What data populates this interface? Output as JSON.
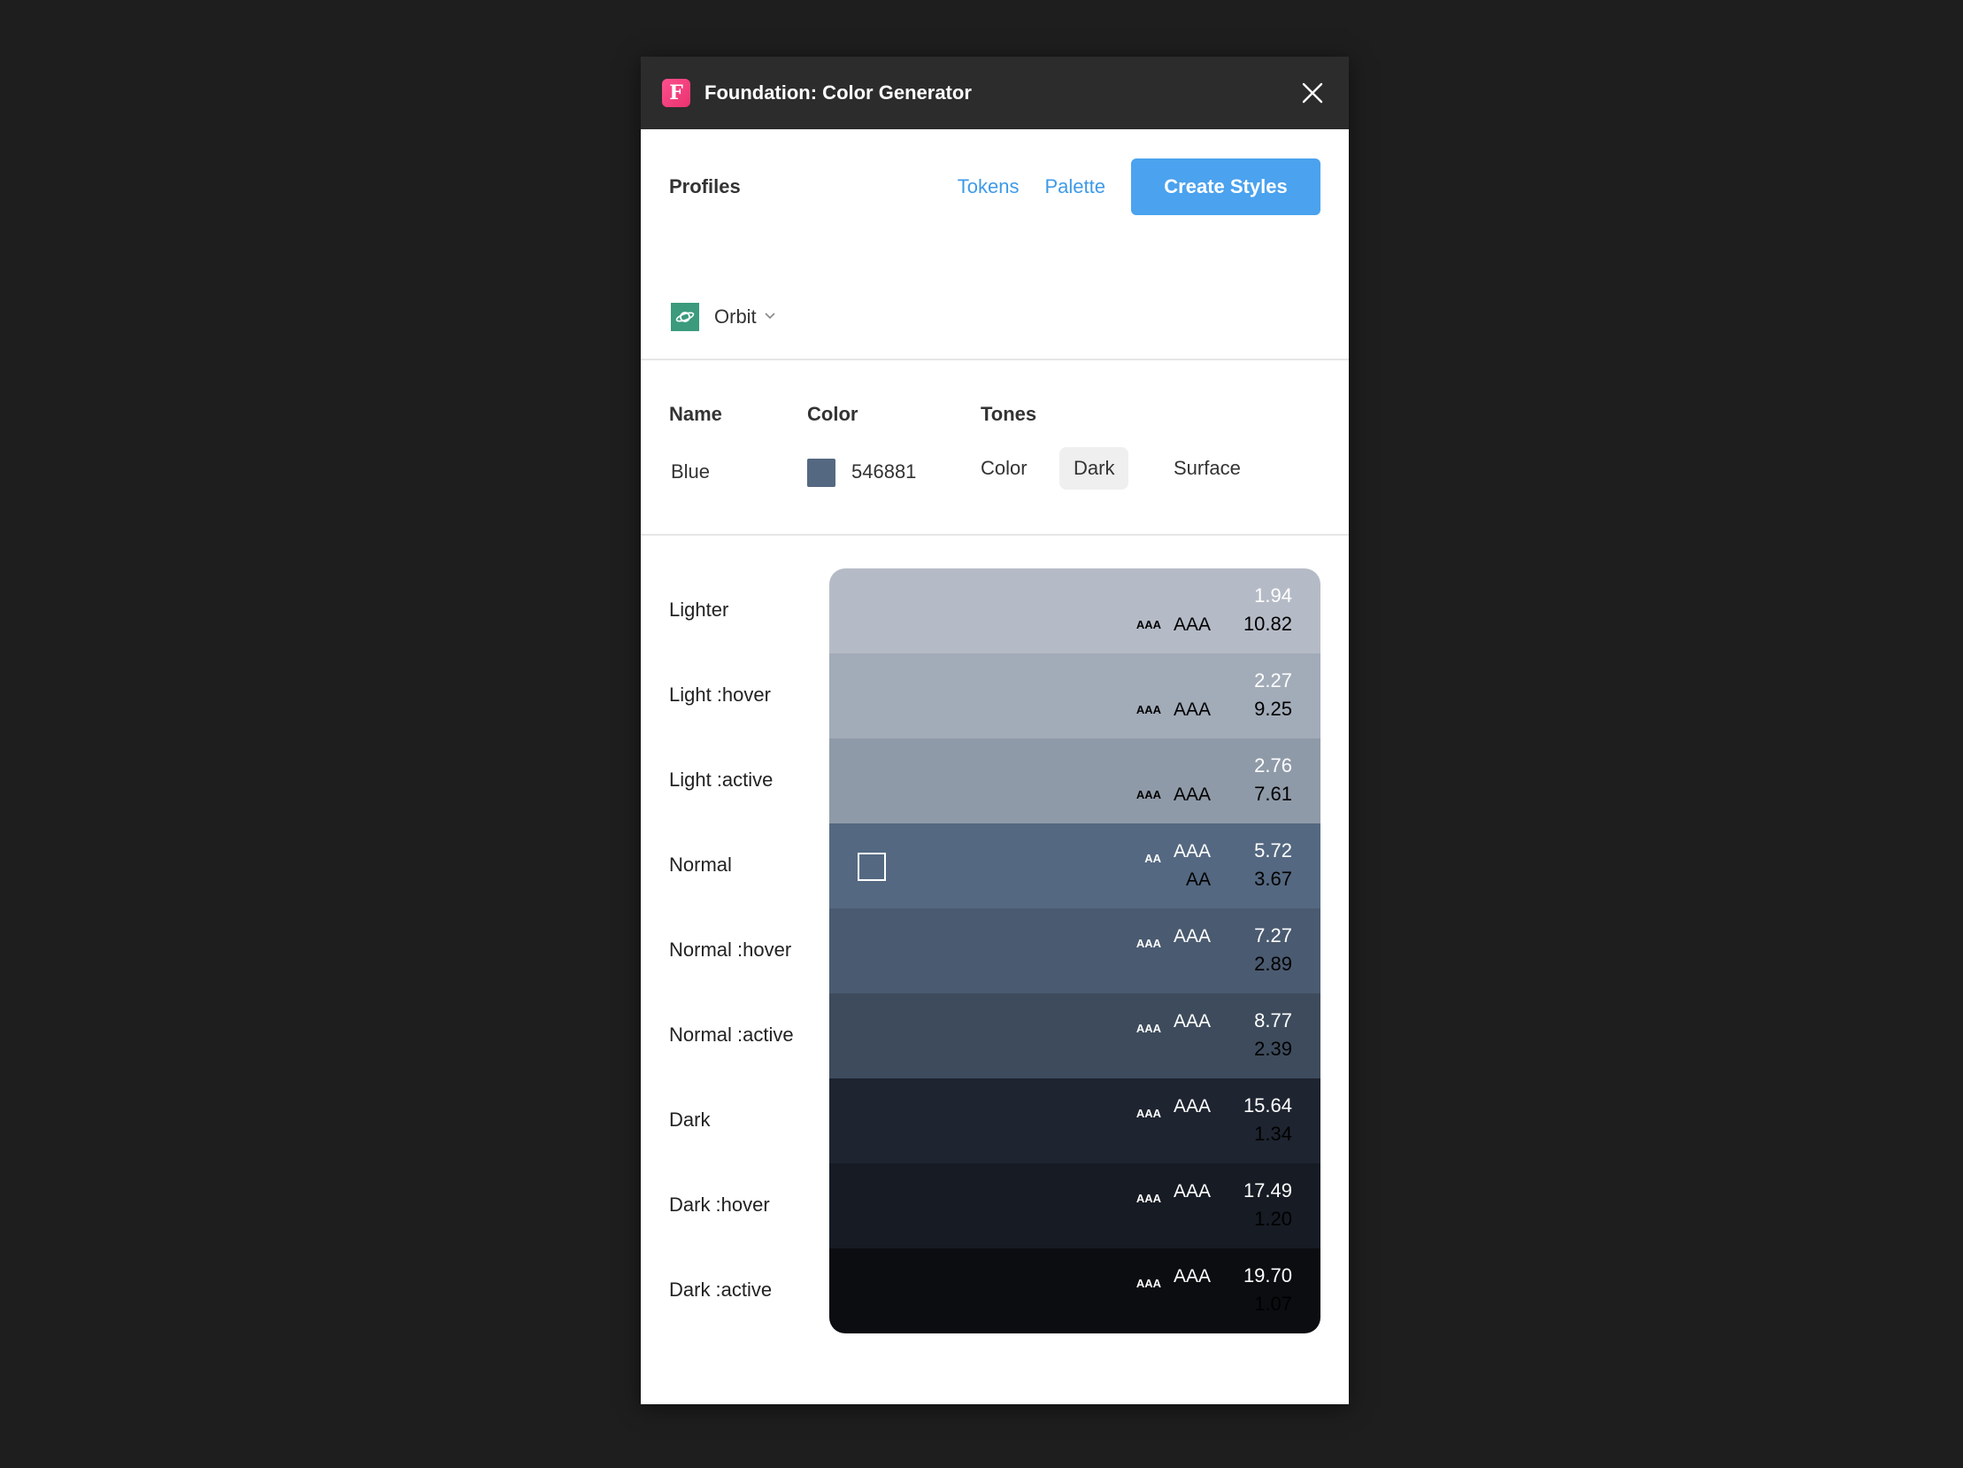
{
  "window": {
    "title": "Foundation: Color Generator",
    "app_icon_letter": "F"
  },
  "header": {
    "profiles_label": "Profiles",
    "tokens_link": "Tokens",
    "palette_link": "Palette",
    "create_button": "Create Styles",
    "profile_name": "Orbit"
  },
  "color_table": {
    "name_header": "Name",
    "color_header": "Color",
    "tones_header": "Tones",
    "name_value": "Blue",
    "color_hex": "546881",
    "swatch_color": "#546881",
    "tones": [
      "Color",
      "Dark",
      "Surface"
    ],
    "active_tone": "Dark"
  },
  "shades": [
    {
      "label": "Lighter",
      "color": "#b5bbc6",
      "top_num": "1.94",
      "bottom_num": "10.82",
      "top_small": "",
      "top_mid": "",
      "bottom_small": "AAA",
      "bottom_mid": "AAA",
      "top_text_color": "#ffffff",
      "bottom_text_color": "#000000"
    },
    {
      "label": "Light :hover",
      "color": "#a2abb8",
      "top_num": "2.27",
      "bottom_num": "9.25",
      "top_small": "",
      "top_mid": "",
      "bottom_small": "AAA",
      "bottom_mid": "AAA",
      "top_text_color": "#ffffff",
      "bottom_text_color": "#000000"
    },
    {
      "label": "Light :active",
      "color": "#8f9aa8",
      "top_num": "2.76",
      "bottom_num": "7.61",
      "top_small": "",
      "top_mid": "",
      "bottom_small": "AAA",
      "bottom_mid": "AAA",
      "top_text_color": "#ffffff",
      "bottom_text_color": "#000000"
    },
    {
      "label": "Normal",
      "color": "#546881",
      "top_num": "5.72",
      "bottom_num": "3.67",
      "top_small": "AA",
      "top_mid": "AAA",
      "bottom_small": "",
      "bottom_mid": "AA",
      "top_text_color": "#ffffff",
      "bottom_text_color": "#000000",
      "has_checkbox": true
    },
    {
      "label": "Normal :hover",
      "color": "#4a5a70",
      "top_num": "7.27",
      "bottom_num": "2.89",
      "top_small": "AAA",
      "top_mid": "AAA",
      "bottom_small": "",
      "bottom_mid": "",
      "top_text_color": "#ffffff",
      "bottom_text_color": "#000000"
    },
    {
      "label": "Normal :active",
      "color": "#3d4b5c",
      "top_num": "8.77",
      "bottom_num": "2.39",
      "top_small": "AAA",
      "top_mid": "AAA",
      "bottom_small": "",
      "bottom_mid": "",
      "top_text_color": "#ffffff",
      "bottom_text_color": "#000000"
    },
    {
      "label": "Dark",
      "color": "#1e2430",
      "top_num": "15.64",
      "bottom_num": "1.34",
      "top_small": "AAA",
      "top_mid": "AAA",
      "bottom_small": "",
      "bottom_mid": "",
      "top_text_color": "#ffffff",
      "bottom_text_color": "#000000"
    },
    {
      "label": "Dark :hover",
      "color": "#161b24",
      "top_num": "17.49",
      "bottom_num": "1.20",
      "top_small": "AAA",
      "top_mid": "AAA",
      "bottom_small": "",
      "bottom_mid": "",
      "top_text_color": "#ffffff",
      "bottom_text_color": "#000000"
    },
    {
      "label": "Dark :active",
      "color": "#0b0d11",
      "top_num": "19.70",
      "bottom_num": "1.07",
      "top_small": "AAA",
      "top_mid": "AAA",
      "bottom_small": "",
      "bottom_mid": "",
      "top_text_color": "#ffffff",
      "bottom_text_color": "#000000"
    }
  ]
}
